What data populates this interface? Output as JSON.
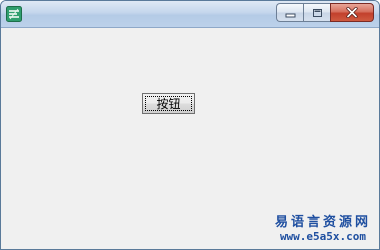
{
  "window": {
    "icon": "app-icon",
    "controls": {
      "minimize_icon": "minimize-icon",
      "maximize_icon": "maximize-icon",
      "close_icon": "close-icon"
    }
  },
  "client": {
    "button_label": "按钮"
  },
  "watermark": {
    "title": "易语言资源网",
    "url": "www.e5a5x.com"
  },
  "colors": {
    "titlebar": "#c4d6ec",
    "client_bg": "#f0f0f0",
    "close_button": "#c2402c",
    "watermark_text": "#1f4fa0"
  }
}
